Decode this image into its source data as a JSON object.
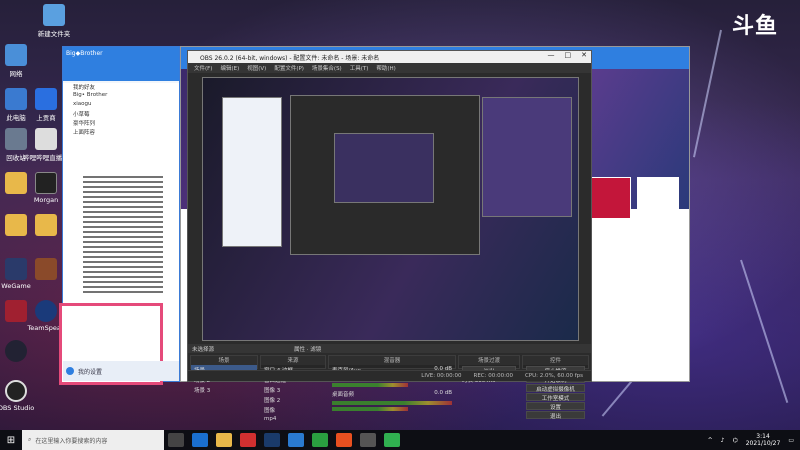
{
  "corner_logo": "斗鱼",
  "desktop_icons": [
    {
      "label": "此电脑",
      "name": "this-pc"
    },
    {
      "label": "网络",
      "name": "network"
    },
    {
      "label": "回收站",
      "name": "recycle-bin"
    },
    {
      "label": "新建文件夹",
      "name": "new-folder"
    },
    {
      "label": "上贡商",
      "name": "shop"
    },
    {
      "label": "哔哩哔哩直播姬",
      "name": "bili"
    },
    {
      "label": "Morgan",
      "name": "morgan"
    },
    {
      "label": "WeGame",
      "name": "wegame"
    },
    {
      "label": "TeamSpeak",
      "name": "teamspeak"
    },
    {
      "label": "OBS Studio",
      "name": "obs"
    }
  ],
  "chat": {
    "title": "Big◆Brother",
    "group_label": "Big• Brother",
    "rows": [
      "我的好友",
      "Big• Brother",
      "xiaogu",
      "小草莓",
      "豪华阵列",
      "上面阵容"
    ],
    "bottom_label": "我的设置"
  },
  "obs": {
    "title": "OBS 26.0.2 (64-bit, windows) - 配置文件: 未命名 - 场景: 未命名",
    "menu": [
      "文件(F)",
      "编辑(E)",
      "视图(V)",
      "配置文件(P)",
      "场景集合(S)",
      "工具(T)",
      "帮助(H)"
    ],
    "scene_bar_label": "未选择源",
    "scene_bar_props": "属性",
    "scene_bar_filters": "滤镜",
    "docks": {
      "scenes": {
        "header": "场景",
        "items": [
          "场景",
          "场景 2",
          "场景 3"
        ]
      },
      "sources": {
        "header": "来源",
        "items": [
          "窗口 4 边框",
          "窗口边框",
          "图像 3",
          "图像 2",
          "图像",
          "mp4"
        ]
      },
      "mixer": {
        "header": "混音器",
        "tracks": [
          {
            "name": "桌面音频",
            "db": "0.0 dB"
          },
          {
            "name": "麦克风/Aux",
            "db": "0.0 dB"
          }
        ]
      },
      "transitions": {
        "header": "场景过渡",
        "type": "淡出",
        "duration_label": "时长",
        "duration": "300 ms"
      },
      "controls": {
        "header": "控件",
        "buttons": [
          "停止推流",
          "开始录制",
          "启动虚拟摄像机",
          "工作室模式",
          "设置",
          "退出"
        ]
      }
    },
    "status": {
      "live": "LIVE: 00:00:00",
      "rec": "REC: 00:00:00",
      "cpu": "CPU: 2.0%, 60.00 fps"
    }
  },
  "taskbar": {
    "search_placeholder": "在这里输入你要搜索的内容",
    "time": "3:14",
    "date": "2021/10/27"
  }
}
